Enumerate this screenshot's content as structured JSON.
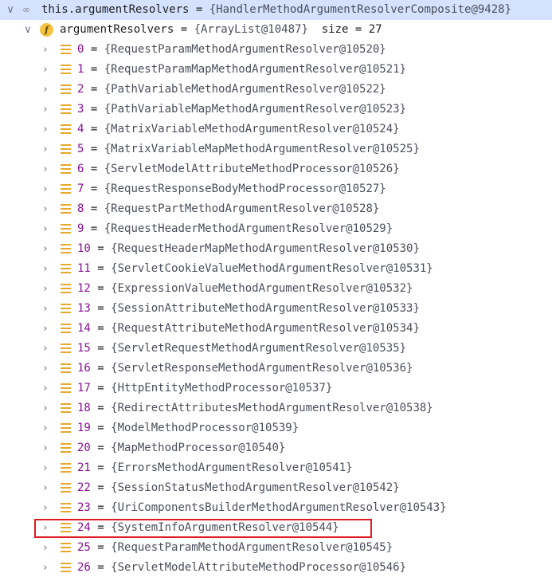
{
  "root": {
    "expression": "this.argumentResolvers",
    "value": "{HandlerMethodArgumentResolverComposite@9428}"
  },
  "field": {
    "name": "argumentResolvers",
    "type_value": "{ArrayList@10487}",
    "size_label": "size = 27"
  },
  "colors": {
    "selected_row": "#d4e2ff",
    "index": "#871094",
    "highlight_border": "#e01a22",
    "field_icon": "#f5c242",
    "element_icon": "#e8a829"
  },
  "items": [
    {
      "index": "0",
      "value": "{RequestParamMethodArgumentResolver@10520}"
    },
    {
      "index": "1",
      "value": "{RequestParamMapMethodArgumentResolver@10521}"
    },
    {
      "index": "2",
      "value": "{PathVariableMethodArgumentResolver@10522}"
    },
    {
      "index": "3",
      "value": "{PathVariableMapMethodArgumentResolver@10523}"
    },
    {
      "index": "4",
      "value": "{MatrixVariableMethodArgumentResolver@10524}"
    },
    {
      "index": "5",
      "value": "{MatrixVariableMapMethodArgumentResolver@10525}"
    },
    {
      "index": "6",
      "value": "{ServletModelAttributeMethodProcessor@10526}"
    },
    {
      "index": "7",
      "value": "{RequestResponseBodyMethodProcessor@10527}"
    },
    {
      "index": "8",
      "value": "{RequestPartMethodArgumentResolver@10528}"
    },
    {
      "index": "9",
      "value": "{RequestHeaderMethodArgumentResolver@10529}"
    },
    {
      "index": "10",
      "value": "{RequestHeaderMapMethodArgumentResolver@10530}"
    },
    {
      "index": "11",
      "value": "{ServletCookieValueMethodArgumentResolver@10531}"
    },
    {
      "index": "12",
      "value": "{ExpressionValueMethodArgumentResolver@10532}"
    },
    {
      "index": "13",
      "value": "{SessionAttributeMethodArgumentResolver@10533}"
    },
    {
      "index": "14",
      "value": "{RequestAttributeMethodArgumentResolver@10534}"
    },
    {
      "index": "15",
      "value": "{ServletRequestMethodArgumentResolver@10535}"
    },
    {
      "index": "16",
      "value": "{ServletResponseMethodArgumentResolver@10536}"
    },
    {
      "index": "17",
      "value": "{HttpEntityMethodProcessor@10537}"
    },
    {
      "index": "18",
      "value": "{RedirectAttributesMethodArgumentResolver@10538}"
    },
    {
      "index": "19",
      "value": "{ModelMethodProcessor@10539}"
    },
    {
      "index": "20",
      "value": "{MapMethodProcessor@10540}"
    },
    {
      "index": "21",
      "value": "{ErrorsMethodArgumentResolver@10541}"
    },
    {
      "index": "22",
      "value": "{SessionStatusMethodArgumentResolver@10542}"
    },
    {
      "index": "23",
      "value": "{UriComponentsBuilderMethodArgumentResolver@10543}"
    },
    {
      "index": "24",
      "value": "{SystemInfoArgumentResolver@10544}"
    },
    {
      "index": "25",
      "value": "{RequestParamMethodArgumentResolver@10545}"
    },
    {
      "index": "26",
      "value": "{ServletModelAttributeMethodProcessor@10546}"
    }
  ]
}
